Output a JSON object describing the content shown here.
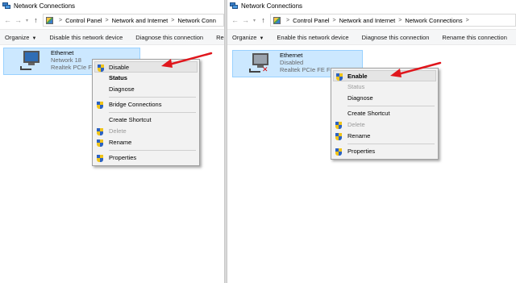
{
  "colors": {
    "selection_bg": "#cce8ff",
    "arrow": "#e0161c",
    "menu_bg": "#f2f2f2"
  },
  "left": {
    "title": "Network Connections",
    "nav": {
      "back": "←",
      "forward": "→",
      "dropdown": "▾",
      "up": "↑"
    },
    "breadcrumbs": [
      "Control Panel",
      "Network and Internet",
      "Network Conn"
    ],
    "breadcrumb_sep": ">",
    "toolbar": {
      "organize": "Organize",
      "disable": "Disable this network device",
      "diagnose": "Diagnose this connection",
      "more": "Rename this c"
    },
    "adapter": {
      "name": "Ethernet",
      "status": "Network  18",
      "device": "Realtek PCIe FE"
    },
    "menu": {
      "disable": "Disable",
      "status": "Status",
      "diagnose": "Diagnose",
      "bridge": "Bridge Connections",
      "shortcut": "Create Shortcut",
      "delete": "Delete",
      "rename": "Rename",
      "properties": "Properties"
    }
  },
  "right": {
    "title": "Network Connections",
    "nav": {
      "back": "←",
      "forward": "→",
      "dropdown": "▾",
      "up": "↑"
    },
    "breadcrumbs": [
      "Control Panel",
      "Network and Internet",
      "Network Connections"
    ],
    "breadcrumb_sep": ">",
    "toolbar": {
      "organize": "Organize",
      "enable": "Enable this network device",
      "diagnose": "Diagnose this connection",
      "rename": "Rename this connection"
    },
    "adapter": {
      "name": "Ethernet",
      "status": "Disabled",
      "device": "Realtek PCIe FE Fa"
    },
    "menu": {
      "enable": "Enable",
      "status": "Status",
      "diagnose": "Diagnose",
      "shortcut": "Create Shortcut",
      "delete": "Delete",
      "rename": "Rename",
      "properties": "Properties"
    }
  }
}
